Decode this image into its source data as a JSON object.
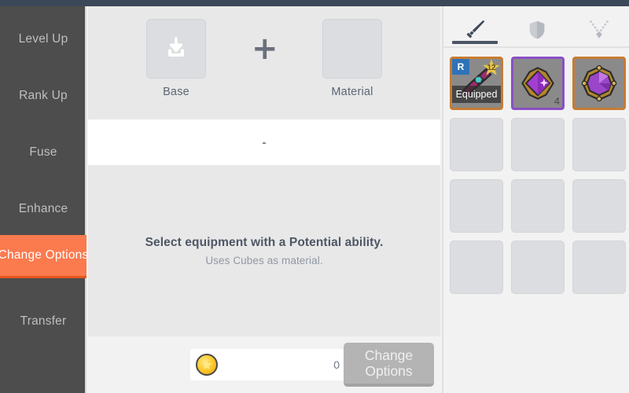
{
  "theme": {
    "topbar_color": "#3c4858",
    "sidebar_color": "#4d4d4d",
    "accent_color": "#fb7a4e",
    "panel_color": "#e8e8e8",
    "disabled_button_color": "#b4b4b4"
  },
  "sidebar": {
    "items": [
      {
        "label": "Level Up",
        "active": false
      },
      {
        "label": "Rank Up",
        "active": false
      },
      {
        "label": "Fuse",
        "active": false
      },
      {
        "label": "Enhance",
        "active": false
      },
      {
        "label": "Change Options",
        "active": true
      },
      {
        "label": "Transfer",
        "active": false
      }
    ]
  },
  "craft": {
    "base_slot": {
      "label": "Base",
      "icon": "inbox-download-icon",
      "empty": true
    },
    "operator": "+",
    "material_slot": {
      "label": "Material",
      "icon": "",
      "empty": true
    },
    "result_text": "-",
    "info_title": "Select equipment with a Potential ability.",
    "info_subtitle": "Uses Cubes as material."
  },
  "footer": {
    "currency_icon": "gold-coin-icon",
    "cost_value": "0",
    "action_label": "Change Options",
    "action_disabled": true
  },
  "inventory": {
    "tabs": [
      {
        "icon": "sword-icon",
        "active": true
      },
      {
        "icon": "shield-icon",
        "active": false
      },
      {
        "icon": "necklace-icon",
        "active": false
      }
    ],
    "items": [
      {
        "sprite": "pink-dagger-sprite",
        "rarity_letter": "R",
        "star_level": "12",
        "status": "Equipped",
        "quantity": "",
        "frame": "rare-orange"
      },
      {
        "sprite": "purple-cube-sprite",
        "rarity_letter": "",
        "star_level": "",
        "status": "",
        "quantity": "4",
        "frame": "rare-purple"
      },
      {
        "sprite": "purple-gem-sprite",
        "rarity_letter": "",
        "star_level": "",
        "status": "",
        "quantity": "",
        "frame": "rare-orange"
      }
    ],
    "empty_slot_count": 9
  }
}
